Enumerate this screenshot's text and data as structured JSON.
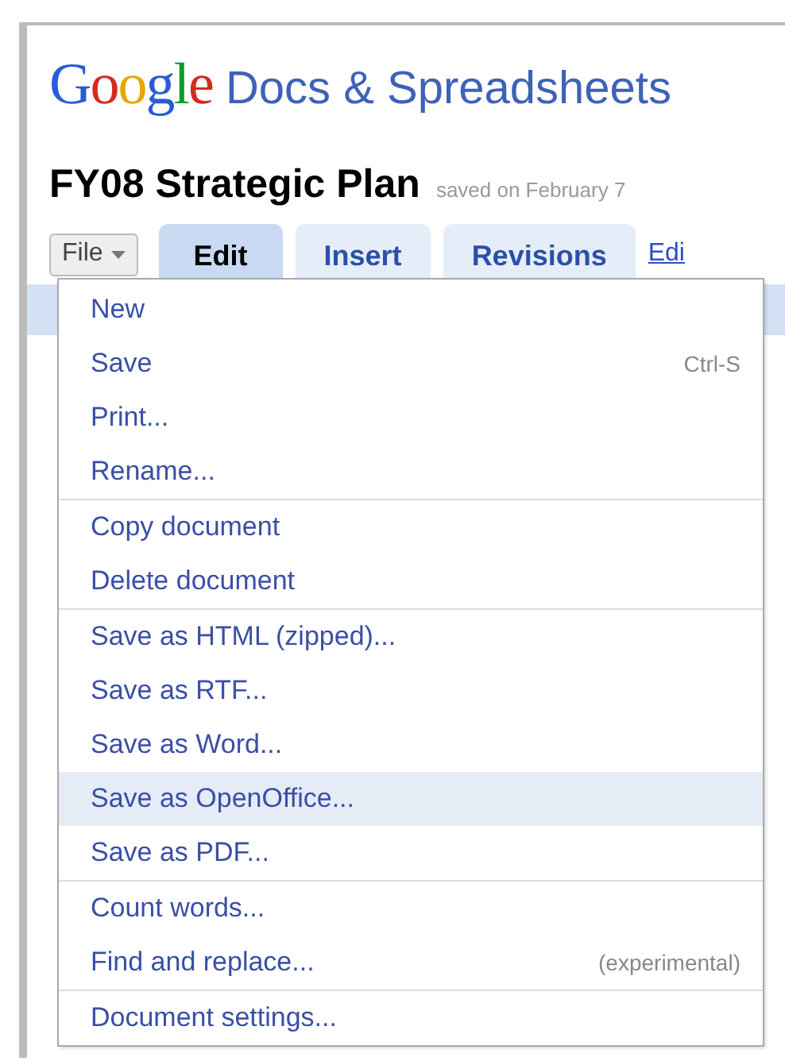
{
  "header": {
    "logo": "Google",
    "product": "Docs & Spreadsheets"
  },
  "document": {
    "title": "FY08 Strategic Plan",
    "status": "saved on February 7"
  },
  "file_button": {
    "label": "File",
    "expanded": true
  },
  "tabs": [
    {
      "label": "Edit",
      "selected": true
    },
    {
      "label": "Insert",
      "selected": false
    },
    {
      "label": "Revisions",
      "selected": false
    }
  ],
  "link": "Edi",
  "menu": {
    "groups": [
      [
        {
          "label": "New",
          "selected": false
        },
        {
          "label": "Save",
          "shortcut": "Ctrl-S",
          "selected": false
        },
        {
          "label": "Print...",
          "selected": false
        },
        {
          "label": "Rename...",
          "selected": false
        }
      ],
      [
        {
          "label": "Copy document",
          "selected": false
        },
        {
          "label": "Delete document",
          "selected": false
        }
      ],
      [
        {
          "label": "Save as HTML (zipped)...",
          "selected": false
        },
        {
          "label": "Save as RTF...",
          "selected": false
        },
        {
          "label": "Save as Word...",
          "selected": false
        },
        {
          "label": "Save as OpenOffice...",
          "selected": true
        },
        {
          "label": "Save as PDF...",
          "selected": false
        }
      ],
      [
        {
          "label": "Count words...",
          "selected": false
        },
        {
          "label": "Find and replace...",
          "shortcut": "(experimental)",
          "selected": false
        }
      ],
      [
        {
          "label": "Document settings...",
          "selected": false
        }
      ]
    ]
  }
}
